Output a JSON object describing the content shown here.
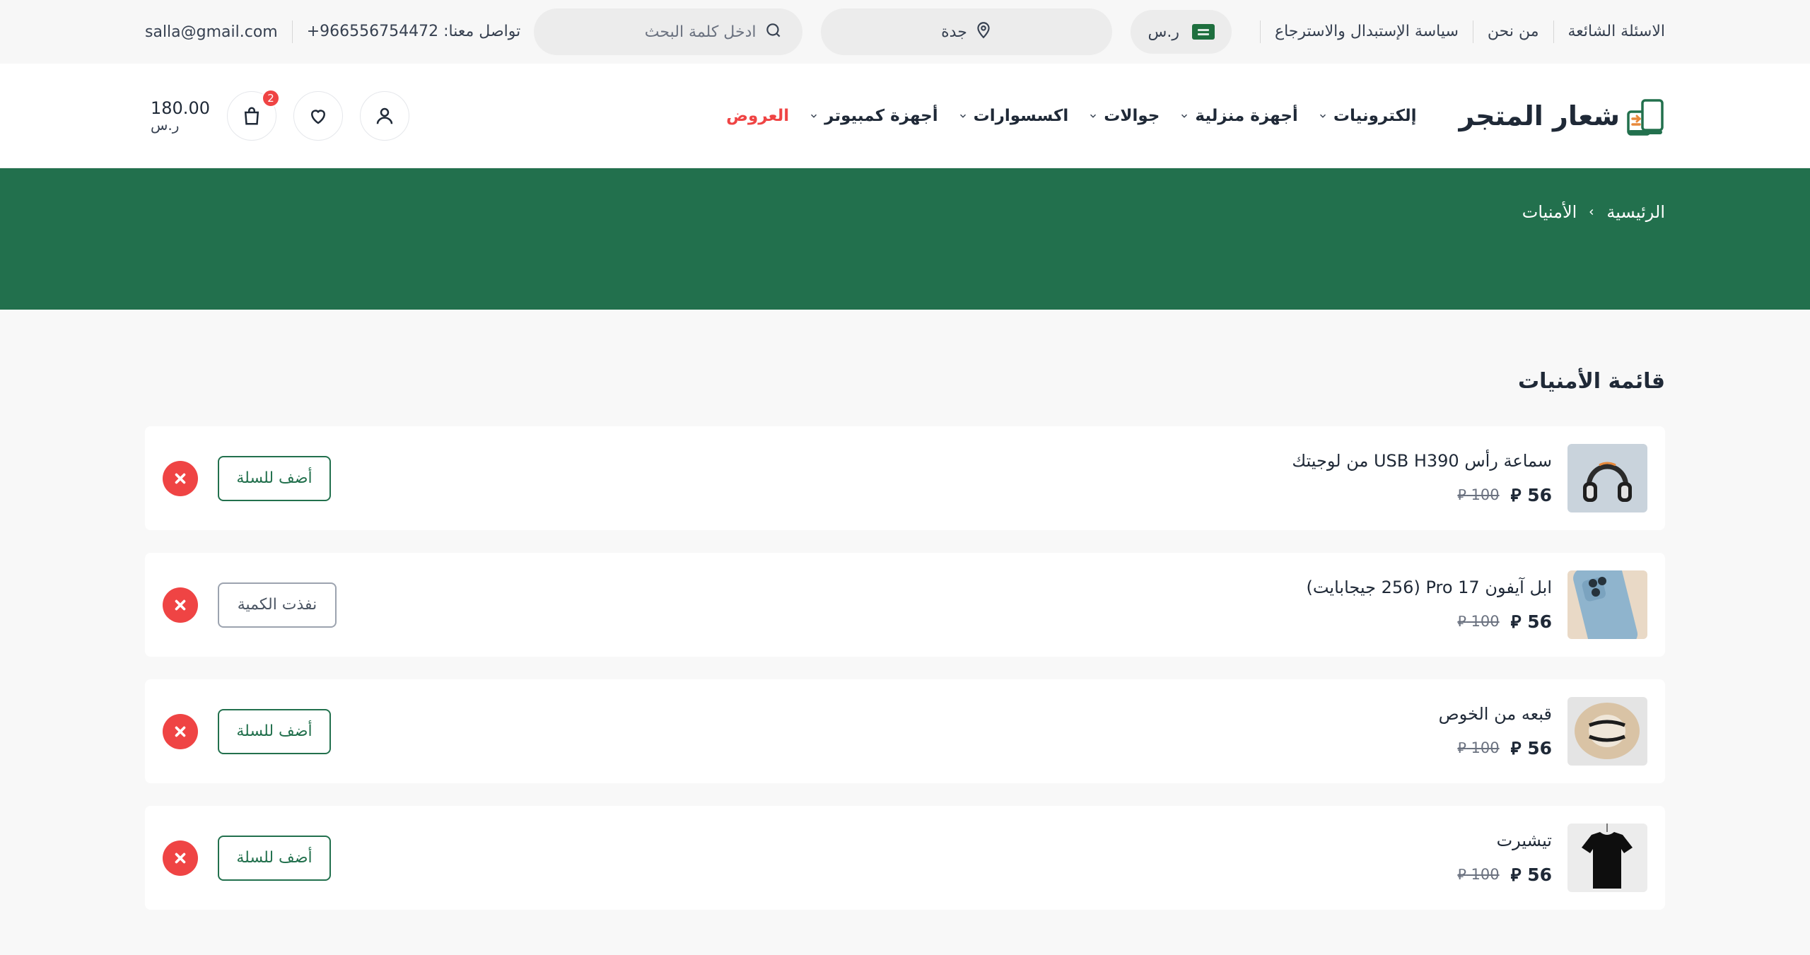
{
  "topbar": {
    "links": [
      "الاسئلة الشائعة",
      "من نحن",
      "سياسة الإستبدال والاسترجاع"
    ],
    "currency": "ر.س",
    "city": "جدة",
    "search_placeholder": "ادخل كلمة البحث",
    "contact_label": "تواصل معنا:",
    "contact_phone": "+966556754472",
    "email": "salla@gmail.com"
  },
  "header": {
    "logo_text": "شعار المتجر",
    "nav": [
      {
        "label": "إلكترونيات"
      },
      {
        "label": "أجهزة منزلية"
      },
      {
        "label": "جوالات"
      },
      {
        "label": "اكسسوارات"
      },
      {
        "label": "أجهزة كمبيوتر"
      },
      {
        "label": "العروض"
      }
    ],
    "cart_count": "2",
    "cart_total": "180.00",
    "cart_currency": "ر.س"
  },
  "breadcrumb": {
    "home": "الرئيسية",
    "current": "الأمنيات"
  },
  "colors": {
    "brand": "#22704d",
    "danger": "#ef4444"
  },
  "wishlist": {
    "title": "قائمة الأمنيات",
    "items": [
      {
        "name": "سماعة رأس USB H390 من لوجيتك",
        "price": "56",
        "old_price": "100",
        "action": "أضف للسلة",
        "in_stock": true,
        "thumb": "headphones"
      },
      {
        "name": "ابل آيفون 17 Pro (256 جيجابايت)",
        "price": "56",
        "old_price": "100",
        "action": "نفذت الكمية",
        "in_stock": false,
        "thumb": "iphone"
      },
      {
        "name": "قبعه من الخوص",
        "price": "56",
        "old_price": "100",
        "action": "أضف للسلة",
        "in_stock": true,
        "thumb": "hat"
      },
      {
        "name": "تيشيرت",
        "price": "56",
        "old_price": "100",
        "action": "أضف للسلة",
        "in_stock": true,
        "thumb": "tshirt"
      }
    ]
  }
}
